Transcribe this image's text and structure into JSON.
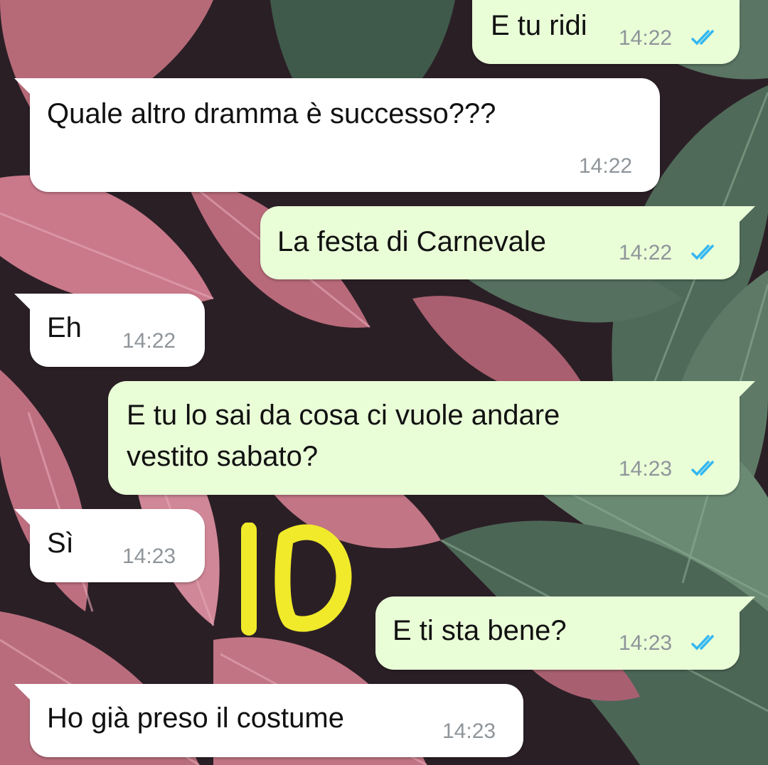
{
  "colors": {
    "outgoing_bubble": "#e9fdd7",
    "incoming_bubble": "#ffffff",
    "timestamp": "#8f959a",
    "read_ticks": "#34b7f1",
    "overlay_mark": "#f0ea2a"
  },
  "messages": [
    {
      "direction": "out",
      "text": "E tu ridi",
      "time": "14:22",
      "status": "read"
    },
    {
      "direction": "in",
      "text": "Quale altro dramma è successo???",
      "time": "14:22"
    },
    {
      "direction": "out",
      "text": "La festa di Carnevale",
      "time": "14:22",
      "status": "read"
    },
    {
      "direction": "in",
      "text": "Eh",
      "time": "14:22"
    },
    {
      "direction": "out",
      "text_line1": "E tu lo sai da cosa ci vuole andare",
      "text_line2": "vestito sabato?",
      "time": "14:23",
      "status": "read"
    },
    {
      "direction": "in",
      "text": "Sì",
      "time": "14:23"
    },
    {
      "direction": "out",
      "text": "E ti sta bene?",
      "time": "14:23",
      "status": "read"
    },
    {
      "direction": "in",
      "text": "Ho già preso il costume",
      "time": "14:23"
    }
  ],
  "overlay": {
    "text": "IO",
    "icon": "handwritten-yellow-scribble"
  },
  "icons": {
    "read_receipt": "double-check-icon"
  }
}
